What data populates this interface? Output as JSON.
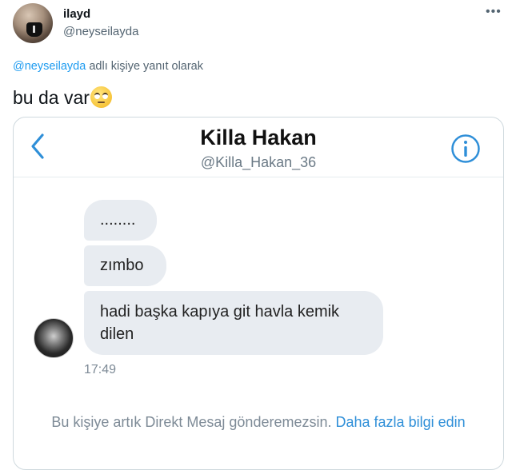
{
  "tweet": {
    "display_name": "ilayd",
    "handle": "@neyseilayda",
    "more_icon": "more-dots-icon",
    "reply_mention": "@neyseilayda",
    "reply_suffix": "adlı kişiye yanıt olarak",
    "text": "bu da var",
    "emoji": "eye-roll-emoji"
  },
  "screenshot": {
    "title": "Killa Hakan",
    "handle": "@Killa_Hakan_36",
    "back_icon": "back-chevron-icon",
    "info_icon": "info-icon",
    "messages": [
      {
        "text": "........"
      },
      {
        "text": "zımbo"
      },
      {
        "text": "hadi başka kapıya git havla kemik dilen"
      }
    ],
    "time": "17:49",
    "notice_text": "Bu kişiye artık Direkt Mesaj gönderemezsin.",
    "notice_link": "Daha fazla bilgi edin",
    "colors": {
      "accent": "#2f8fd8",
      "bubble": "#e8ecf1",
      "muted": "#7d8a96"
    }
  }
}
